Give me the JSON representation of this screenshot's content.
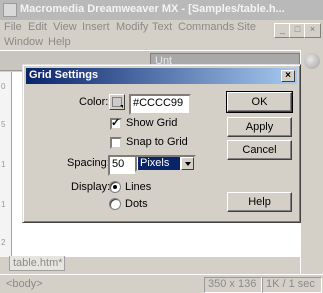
{
  "app": {
    "title": "Macromedia Dreamweaver MX - [Samples/table.h...",
    "menu_row1": [
      "File",
      "Edit",
      "View",
      "Insert",
      "Modify",
      "Text",
      "Commands",
      "Site"
    ],
    "menu_row2": [
      "Window",
      "Help"
    ],
    "doc_title_field": "Unt",
    "ruler_numbers": [
      "0",
      "5",
      "1",
      "1",
      "2"
    ],
    "doc_tab": "table.htm*",
    "status": {
      "tag": "<body>",
      "window_size": "350 x 136",
      "download": "1K / 1 sec"
    }
  },
  "dialog": {
    "title": "Grid Settings",
    "close_glyph": "×",
    "color_label": "Color:",
    "color_value": "#CCCC99",
    "show_grid_label": "Show Grid",
    "show_grid_checked": true,
    "snap_label": "Snap to Grid",
    "snap_checked": false,
    "spacing_label": "Spacing:",
    "spacing_value": "50",
    "units_value": "Pixels",
    "display_label": "Display:",
    "display_options": [
      "Lines",
      "Dots"
    ],
    "display_selected": "Lines",
    "buttons": {
      "ok": "OK",
      "apply": "Apply",
      "cancel": "Cancel",
      "help": "Help"
    }
  },
  "colors": {
    "dialog_bg": "#d4d0c8",
    "title_active_start": "#0a246a",
    "title_active_end": "#a6caf0",
    "inactive_title": "#b9b9b9"
  }
}
